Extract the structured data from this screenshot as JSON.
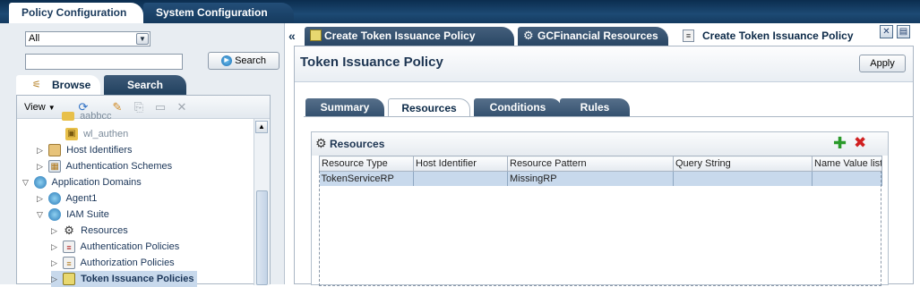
{
  "top_tabs": [
    "Policy Configuration",
    "System Configuration"
  ],
  "left": {
    "filter_select": "All",
    "search_button": "Search",
    "tabs": [
      "Browse",
      "Search"
    ],
    "view_menu": "View",
    "tree": [
      {
        "label": "aabbcc",
        "indent": 3
      },
      {
        "label": "wl_authen",
        "indent": 3
      },
      {
        "label": "Host Identifiers",
        "indent": 1
      },
      {
        "label": "Authentication Schemes",
        "indent": 1
      },
      {
        "label": "Application Domains",
        "indent": 0
      },
      {
        "label": "Agent1",
        "indent": 1
      },
      {
        "label": "IAM Suite",
        "indent": 1
      },
      {
        "label": "Resources",
        "indent": 2
      },
      {
        "label": "Authentication Policies",
        "indent": 2
      },
      {
        "label": "Authorization Policies",
        "indent": 2
      },
      {
        "label": "Token Issuance Policies",
        "indent": 2
      }
    ]
  },
  "right": {
    "collapse": "«",
    "tabs": [
      "Create Token Issuance Policy",
      "GCFinancial Resources",
      "Create Token Issuance Policy"
    ],
    "page_title": "Token Issuance Policy",
    "apply_button": "Apply",
    "inner_tabs": [
      "Summary",
      "Resources",
      "Conditions",
      "Rules"
    ],
    "resources_title": "Resources",
    "table": {
      "columns": [
        "Resource Type",
        "Host Identifier",
        "Resource Pattern",
        "Query String",
        "Name Value list"
      ],
      "rows": [
        [
          "TokenServiceRP",
          "",
          "MissingRP",
          "",
          ""
        ]
      ]
    }
  }
}
